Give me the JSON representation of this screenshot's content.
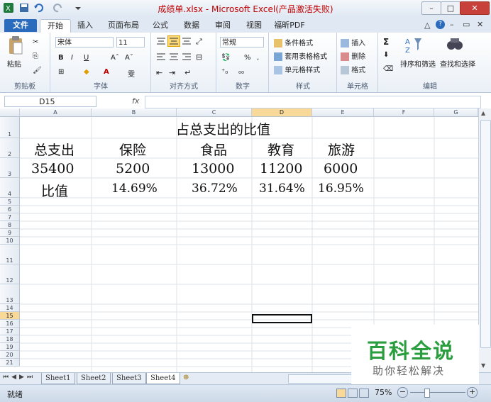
{
  "window": {
    "title": "成绩单.xlsx - Microsoft Excel(产品激活失败)",
    "accent": "#2b6bbd",
    "title_color": "#c00000"
  },
  "tabs": [
    {
      "label": "文件"
    },
    {
      "label": "开始"
    },
    {
      "label": "插入"
    },
    {
      "label": "页面布局"
    },
    {
      "label": "公式"
    },
    {
      "label": "数据"
    },
    {
      "label": "审阅"
    },
    {
      "label": "视图"
    },
    {
      "label": "福昕PDF"
    }
  ],
  "ribbon": {
    "clipboard": {
      "label": "剪贴板",
      "paste": "粘贴"
    },
    "font": {
      "label": "字体",
      "family": "宋体",
      "size": "11",
      "bold": "B",
      "italic": "I",
      "underline": "U",
      "wen": "雯"
    },
    "alignment": {
      "label": "对齐方式"
    },
    "number": {
      "label": "数字",
      "format": "常规"
    },
    "styles": {
      "label": "样式",
      "conditional": "条件格式",
      "table_format": "套用表格格式",
      "cell_styles": "单元格样式"
    },
    "cells": {
      "label": "单元格",
      "insert": "插入",
      "delete": "删除",
      "format": "格式"
    },
    "editing": {
      "label": "编辑",
      "sort_filter": "排序和筛选",
      "find_select": "查找和选择",
      "sigma": "Σ"
    }
  },
  "formula_bar": {
    "name_box": "D15",
    "fx": "fx",
    "content": ""
  },
  "columns": [
    "A",
    "B",
    "C",
    "D",
    "E",
    "F",
    "G"
  ],
  "rows": [
    "1",
    "2",
    "3",
    "4",
    "5",
    "6",
    "7",
    "8",
    "9",
    "10",
    "11",
    "12",
    "13",
    "14",
    "15",
    "16",
    "17",
    "18",
    "19",
    "20",
    "21"
  ],
  "sheet": {
    "title": "占总支出的比值",
    "headers": [
      "总支出",
      "保险",
      "食品",
      "教育",
      "旅游"
    ],
    "values": [
      "35400",
      "5200",
      "13000",
      "11200",
      "6000"
    ],
    "ratio_label": "比值",
    "ratios": [
      "14.69%",
      "36.72%",
      "31.64%",
      "16.95%"
    ]
  },
  "sheet_tabs": [
    "Sheet1",
    "Sheet2",
    "Sheet3",
    "Sheet4"
  ],
  "active_sheet": "Sheet4",
  "status": {
    "ready": "就绪",
    "zoom": "75%"
  },
  "watermark": {
    "main": "百科全说",
    "sub": "助你轻松解决",
    "color": "#2a9e3f"
  }
}
